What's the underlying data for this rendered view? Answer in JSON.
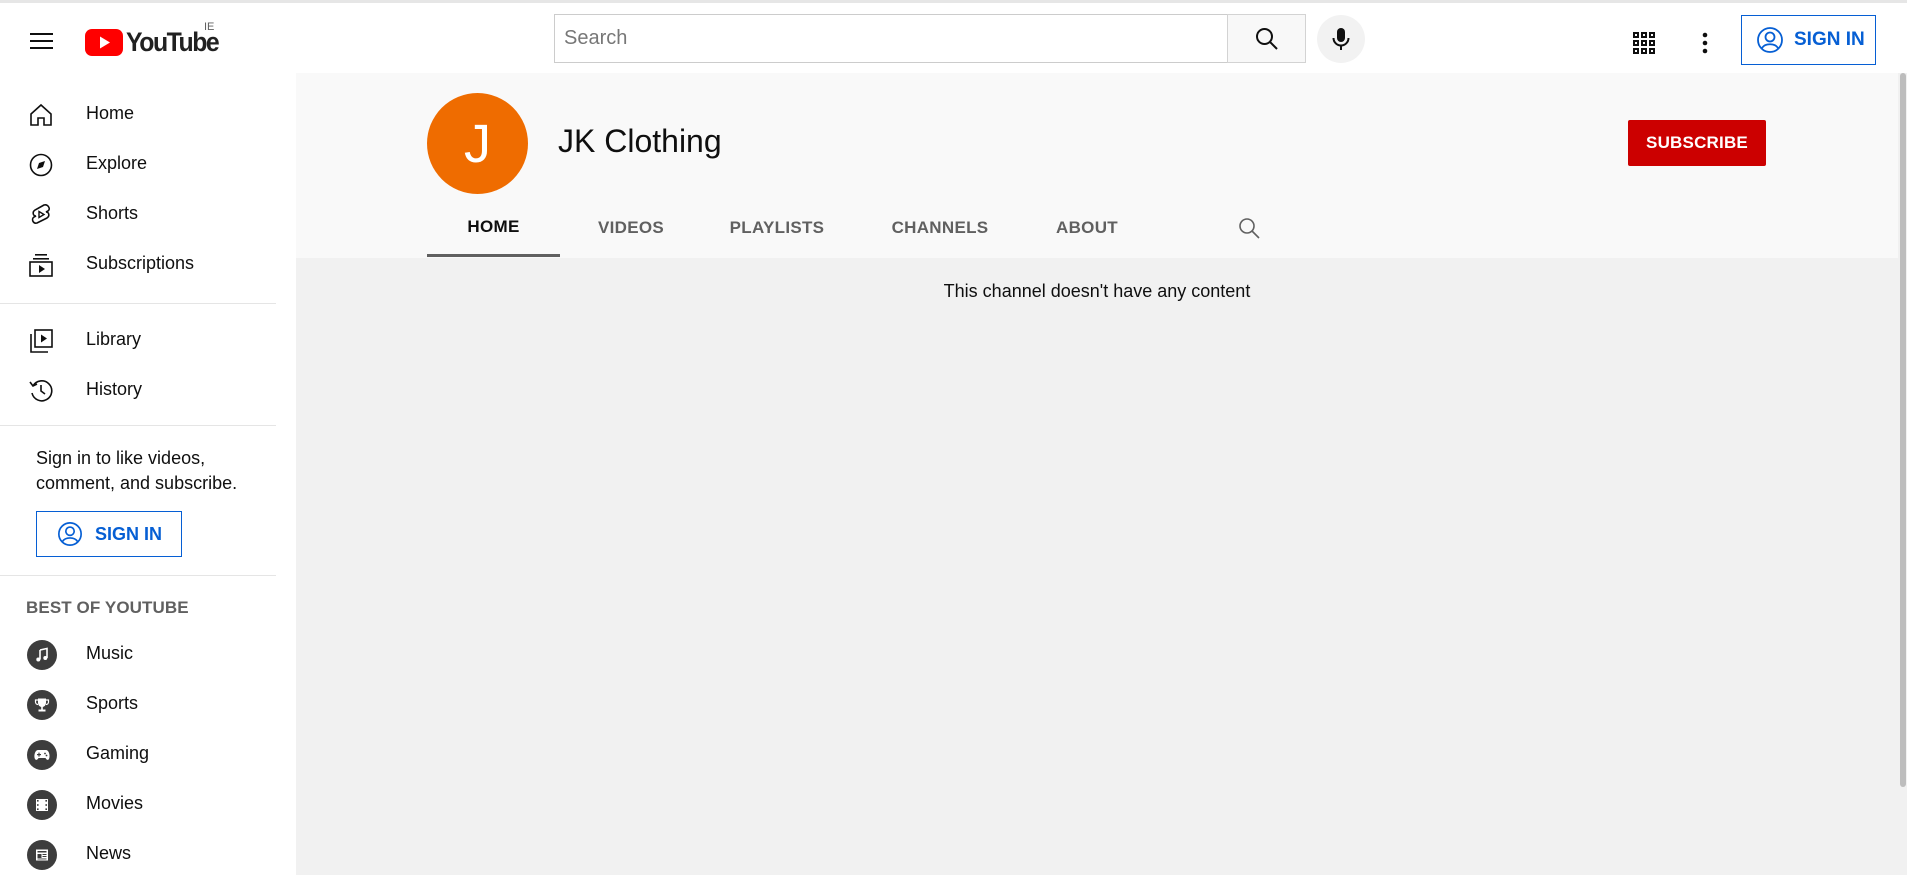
{
  "header": {
    "logo_text": "YouTube",
    "region": "IE",
    "search_placeholder": "Search",
    "signin_label": "SIGN IN"
  },
  "sidebar": {
    "main_items": [
      {
        "label": "Home",
        "icon": "home-icon"
      },
      {
        "label": "Explore",
        "icon": "compass-icon"
      },
      {
        "label": "Shorts",
        "icon": "shorts-icon"
      },
      {
        "label": "Subscriptions",
        "icon": "subscriptions-icon"
      }
    ],
    "library_items": [
      {
        "label": "Library",
        "icon": "library-icon"
      },
      {
        "label": "History",
        "icon": "history-icon"
      }
    ],
    "signin_message": "Sign in to like videos, comment, and subscribe.",
    "signin_label": "SIGN IN",
    "best_of_title": "BEST OF YOUTUBE",
    "best_of_items": [
      {
        "label": "Music",
        "icon": "music-icon"
      },
      {
        "label": "Sports",
        "icon": "trophy-icon"
      },
      {
        "label": "Gaming",
        "icon": "gaming-icon"
      },
      {
        "label": "Movies",
        "icon": "movies-icon"
      },
      {
        "label": "News",
        "icon": "news-icon"
      }
    ]
  },
  "channel": {
    "avatar_letter": "J",
    "avatar_color": "#ef6c00",
    "name": "JK Clothing",
    "subscribe_label": "SUBSCRIBE",
    "tabs": [
      {
        "label": "HOME",
        "active": true
      },
      {
        "label": "VIDEOS",
        "active": false
      },
      {
        "label": "PLAYLISTS",
        "active": false
      },
      {
        "label": "CHANNELS",
        "active": false
      },
      {
        "label": "ABOUT",
        "active": false
      }
    ],
    "empty_message": "This channel doesn't have any content"
  },
  "colors": {
    "brand_red": "#ff0000",
    "subscribe_red": "#cc0000",
    "link_blue": "#065fd4"
  }
}
